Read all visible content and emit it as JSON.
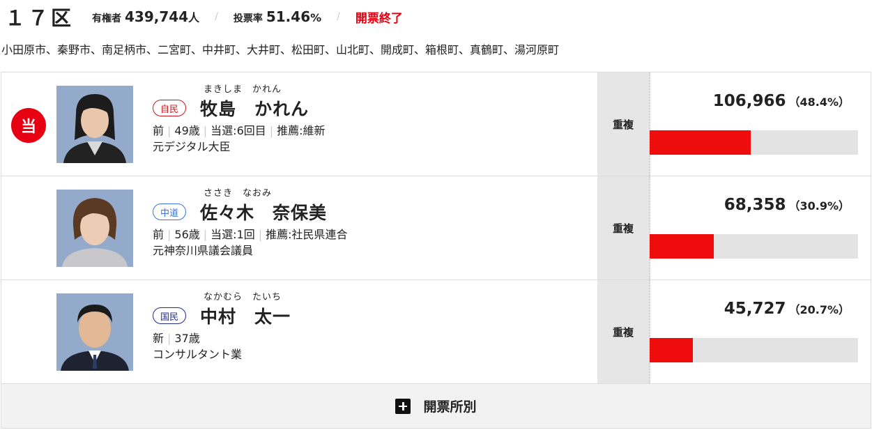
{
  "header": {
    "district": "１７区",
    "voters_label": "有権者",
    "voters_value": "439,744",
    "voters_unit": "人",
    "turnout_label": "投票率",
    "turnout_value": "51.46",
    "turnout_unit": "%",
    "status": "開票終了",
    "separator": "/"
  },
  "areas": "小田原市、秦野市、南足柄市、二宮町、中井町、大井町、松田町、山北町、開成町、箱根町、真鶴町、湯河原町",
  "candidates": [
    {
      "winner": true,
      "winner_badge": "当",
      "ruby": "まきしま　かれん",
      "party": "自民",
      "name": "牧島　かれん",
      "status": "前",
      "age": "49歳",
      "elected": "当選:6回目",
      "endorse": "推薦:維新",
      "career": "元デジタル大臣",
      "duplicate": "重複",
      "votes": "106,966",
      "pct_label": "（48.4%）",
      "pct": 48.4
    },
    {
      "winner": false,
      "ruby": "ささき　なおみ",
      "party": "中道",
      "name": "佐々木　奈保美",
      "status": "前",
      "age": "56歳",
      "elected": "当選:1回",
      "endorse": "推薦:社民県連合",
      "career": "元神奈川県議会議員",
      "duplicate": "重複",
      "votes": "68,358",
      "pct_label": "（30.9%）",
      "pct": 30.9
    },
    {
      "winner": false,
      "ruby": "なかむら　たいち",
      "party": "国民",
      "name": "中村　太一",
      "status": "新",
      "age": "37歳",
      "career": "コンサルタント業",
      "duplicate": "重複",
      "votes": "45,727",
      "pct_label": "（20.7%）",
      "pct": 20.7
    }
  ],
  "footer": {
    "label": "開票所別"
  },
  "colors": {
    "accent": "#e60012",
    "bar_fill": "#ef0c0c",
    "bar_bg": "#e3e3e3",
    "ldp": "#c8161d",
    "cd": "#3b73d9",
    "dpfp": "#1e2a8a"
  },
  "icons": {
    "expand": "plus-square-icon",
    "photo": "candidate-photo"
  }
}
